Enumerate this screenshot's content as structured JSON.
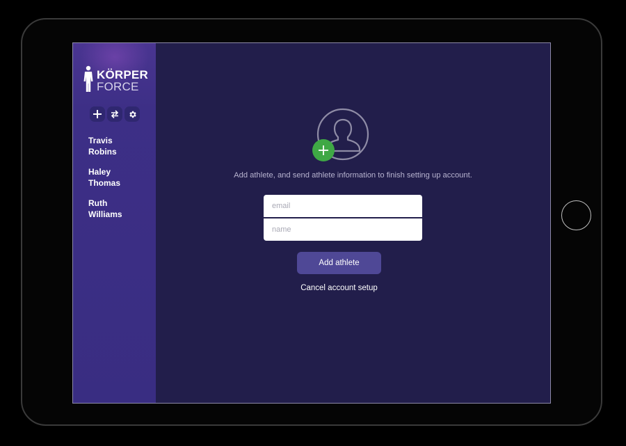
{
  "brand": {
    "line1": "KÖRPER",
    "line2": "FORCE",
    "logo_icon": "person-figure-icon"
  },
  "toolbar": {
    "buttons": [
      {
        "icon": "plus-icon",
        "symbol": "+"
      },
      {
        "icon": "swap-icon",
        "symbol": "⇆"
      },
      {
        "icon": "gear-icon",
        "symbol": "⚙"
      }
    ]
  },
  "sidebar": {
    "athletes": [
      {
        "first": "Travis",
        "last": "Robins"
      },
      {
        "first": "Haley",
        "last": "Thomas"
      },
      {
        "first": "Ruth",
        "last": "Williams"
      }
    ]
  },
  "main": {
    "avatar_icon": "user-avatar-icon",
    "add_icon": "plus-icon",
    "instructions": "Add athlete, and send athlete information to finish setting up account.",
    "email_placeholder": "email",
    "email_value": "",
    "name_placeholder": "name",
    "name_value": "",
    "add_button_label": "Add athlete",
    "cancel_label": "Cancel account setup"
  },
  "colors": {
    "background": "#221e4b",
    "sidebar": "#392d82",
    "accent_green": "#3fa845",
    "button": "#4f4896"
  }
}
